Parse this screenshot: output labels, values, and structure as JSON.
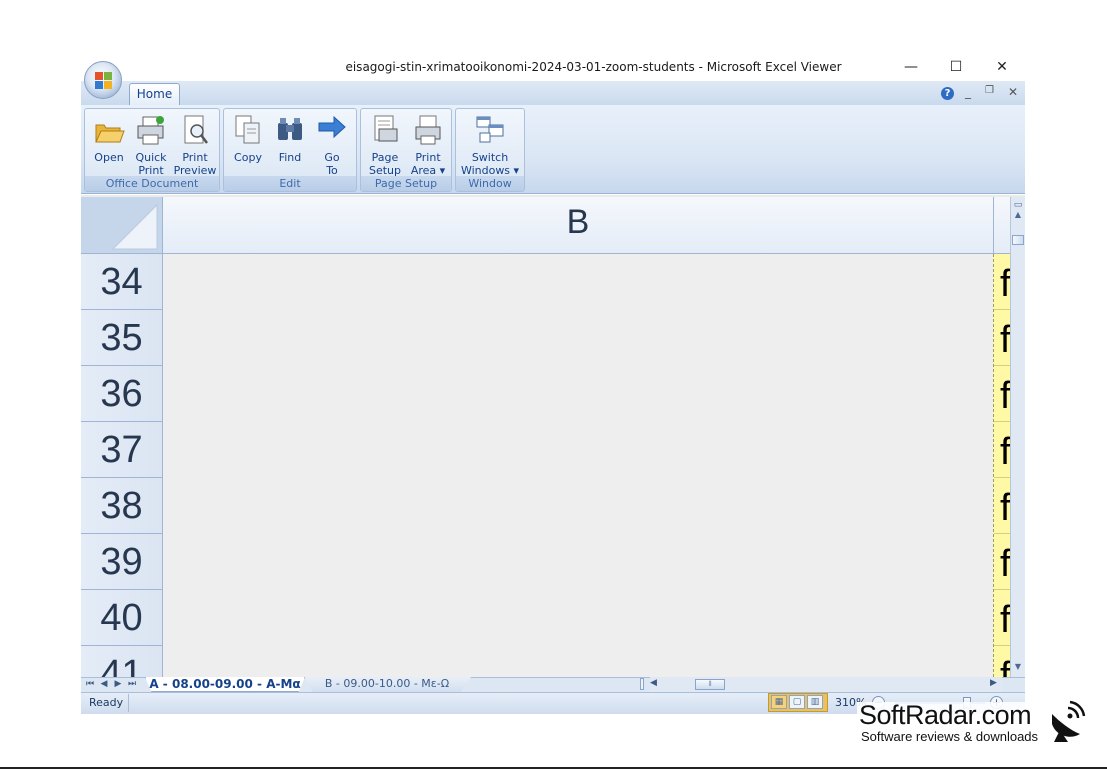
{
  "window": {
    "title": "eisagogi-stin-xrimatooikonomi-2024-03-01-zoom-students - Microsoft Excel Viewer",
    "minimize_glyph": "—",
    "maximize_glyph": "☐",
    "close_glyph": "✕"
  },
  "ribbon": {
    "tabs": [
      {
        "label": "Home",
        "active": true
      }
    ],
    "mdi": {
      "help": "?",
      "minimize": "_",
      "restore": "❐",
      "close": "✕"
    },
    "groups": [
      {
        "label": "Office Document",
        "buttons": [
          {
            "label": "Open",
            "icon": "open-folder-icon"
          },
          {
            "label": "Quick\nPrint",
            "icon": "quick-print-icon"
          },
          {
            "label": "Print\nPreview",
            "icon": "print-preview-icon"
          }
        ]
      },
      {
        "label": "Edit",
        "buttons": [
          {
            "label": "Copy",
            "icon": "copy-icon"
          },
          {
            "label": "Find",
            "icon": "binoculars-icon"
          },
          {
            "label": "Go\nTo",
            "icon": "arrow-right-icon"
          }
        ]
      },
      {
        "label": "Page Setup",
        "buttons": [
          {
            "label": "Page\nSetup",
            "icon": "page-setup-icon"
          },
          {
            "label": "Print\nArea ▾",
            "icon": "print-area-icon"
          }
        ]
      },
      {
        "label": "Window",
        "buttons": [
          {
            "label": "Switch\nWindows ▾",
            "icon": "switch-windows-icon"
          }
        ]
      }
    ]
  },
  "grid": {
    "column_header": "B",
    "row_headers": [
      "34",
      "35",
      "36",
      "37",
      "38",
      "39",
      "40",
      "41"
    ],
    "column_c_visible_char": "f"
  },
  "sheet_tabs": {
    "nav": [
      "⏮",
      "◀",
      "▶",
      "⏭"
    ],
    "tabs": [
      {
        "label": "A - 08.00-09.00 - Α-Μα",
        "active": true
      },
      {
        "label": "B - 09.00-10.00 - Με-Ω",
        "active": false
      }
    ]
  },
  "status": {
    "ready": "Ready",
    "zoom": "310%"
  },
  "watermark": {
    "name": "SoftRadar.com",
    "tagline": "Software reviews & downloads"
  },
  "colors": {
    "ribbon_blue": "#dbe6f4",
    "tab_text": "#15428b",
    "header_fill": "#e4ecf7",
    "highlight_yellow": "#fff9a6",
    "cell_gray": "#eeeeee"
  }
}
